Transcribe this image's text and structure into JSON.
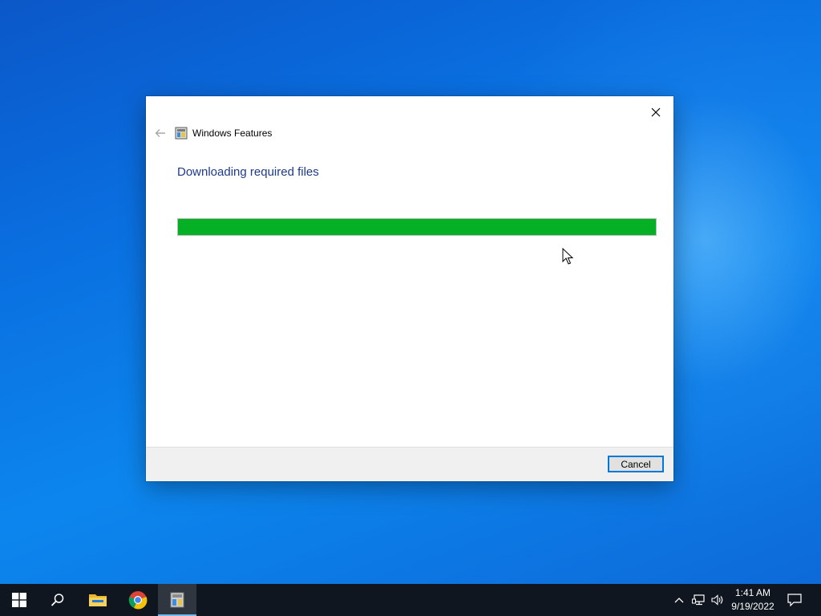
{
  "window": {
    "title": "Windows Features",
    "heading": "Downloading required files",
    "progress_percent": 100,
    "progress_color": "#06b025",
    "cancel_label": "Cancel"
  },
  "taskbar": {
    "apps": [
      {
        "name": "start",
        "icon": "windows-logo-icon"
      },
      {
        "name": "search",
        "icon": "search-icon"
      },
      {
        "name": "file-explorer",
        "icon": "folder-icon"
      },
      {
        "name": "chrome",
        "icon": "chrome-icon"
      },
      {
        "name": "windows-features",
        "icon": "windows-features-icon",
        "active": true
      }
    ],
    "time": "1:41 AM",
    "date": "9/19/2022"
  },
  "colors": {
    "accent": "#0078d7",
    "heading": "#1e3a8a",
    "taskbar": "#0f1620"
  }
}
